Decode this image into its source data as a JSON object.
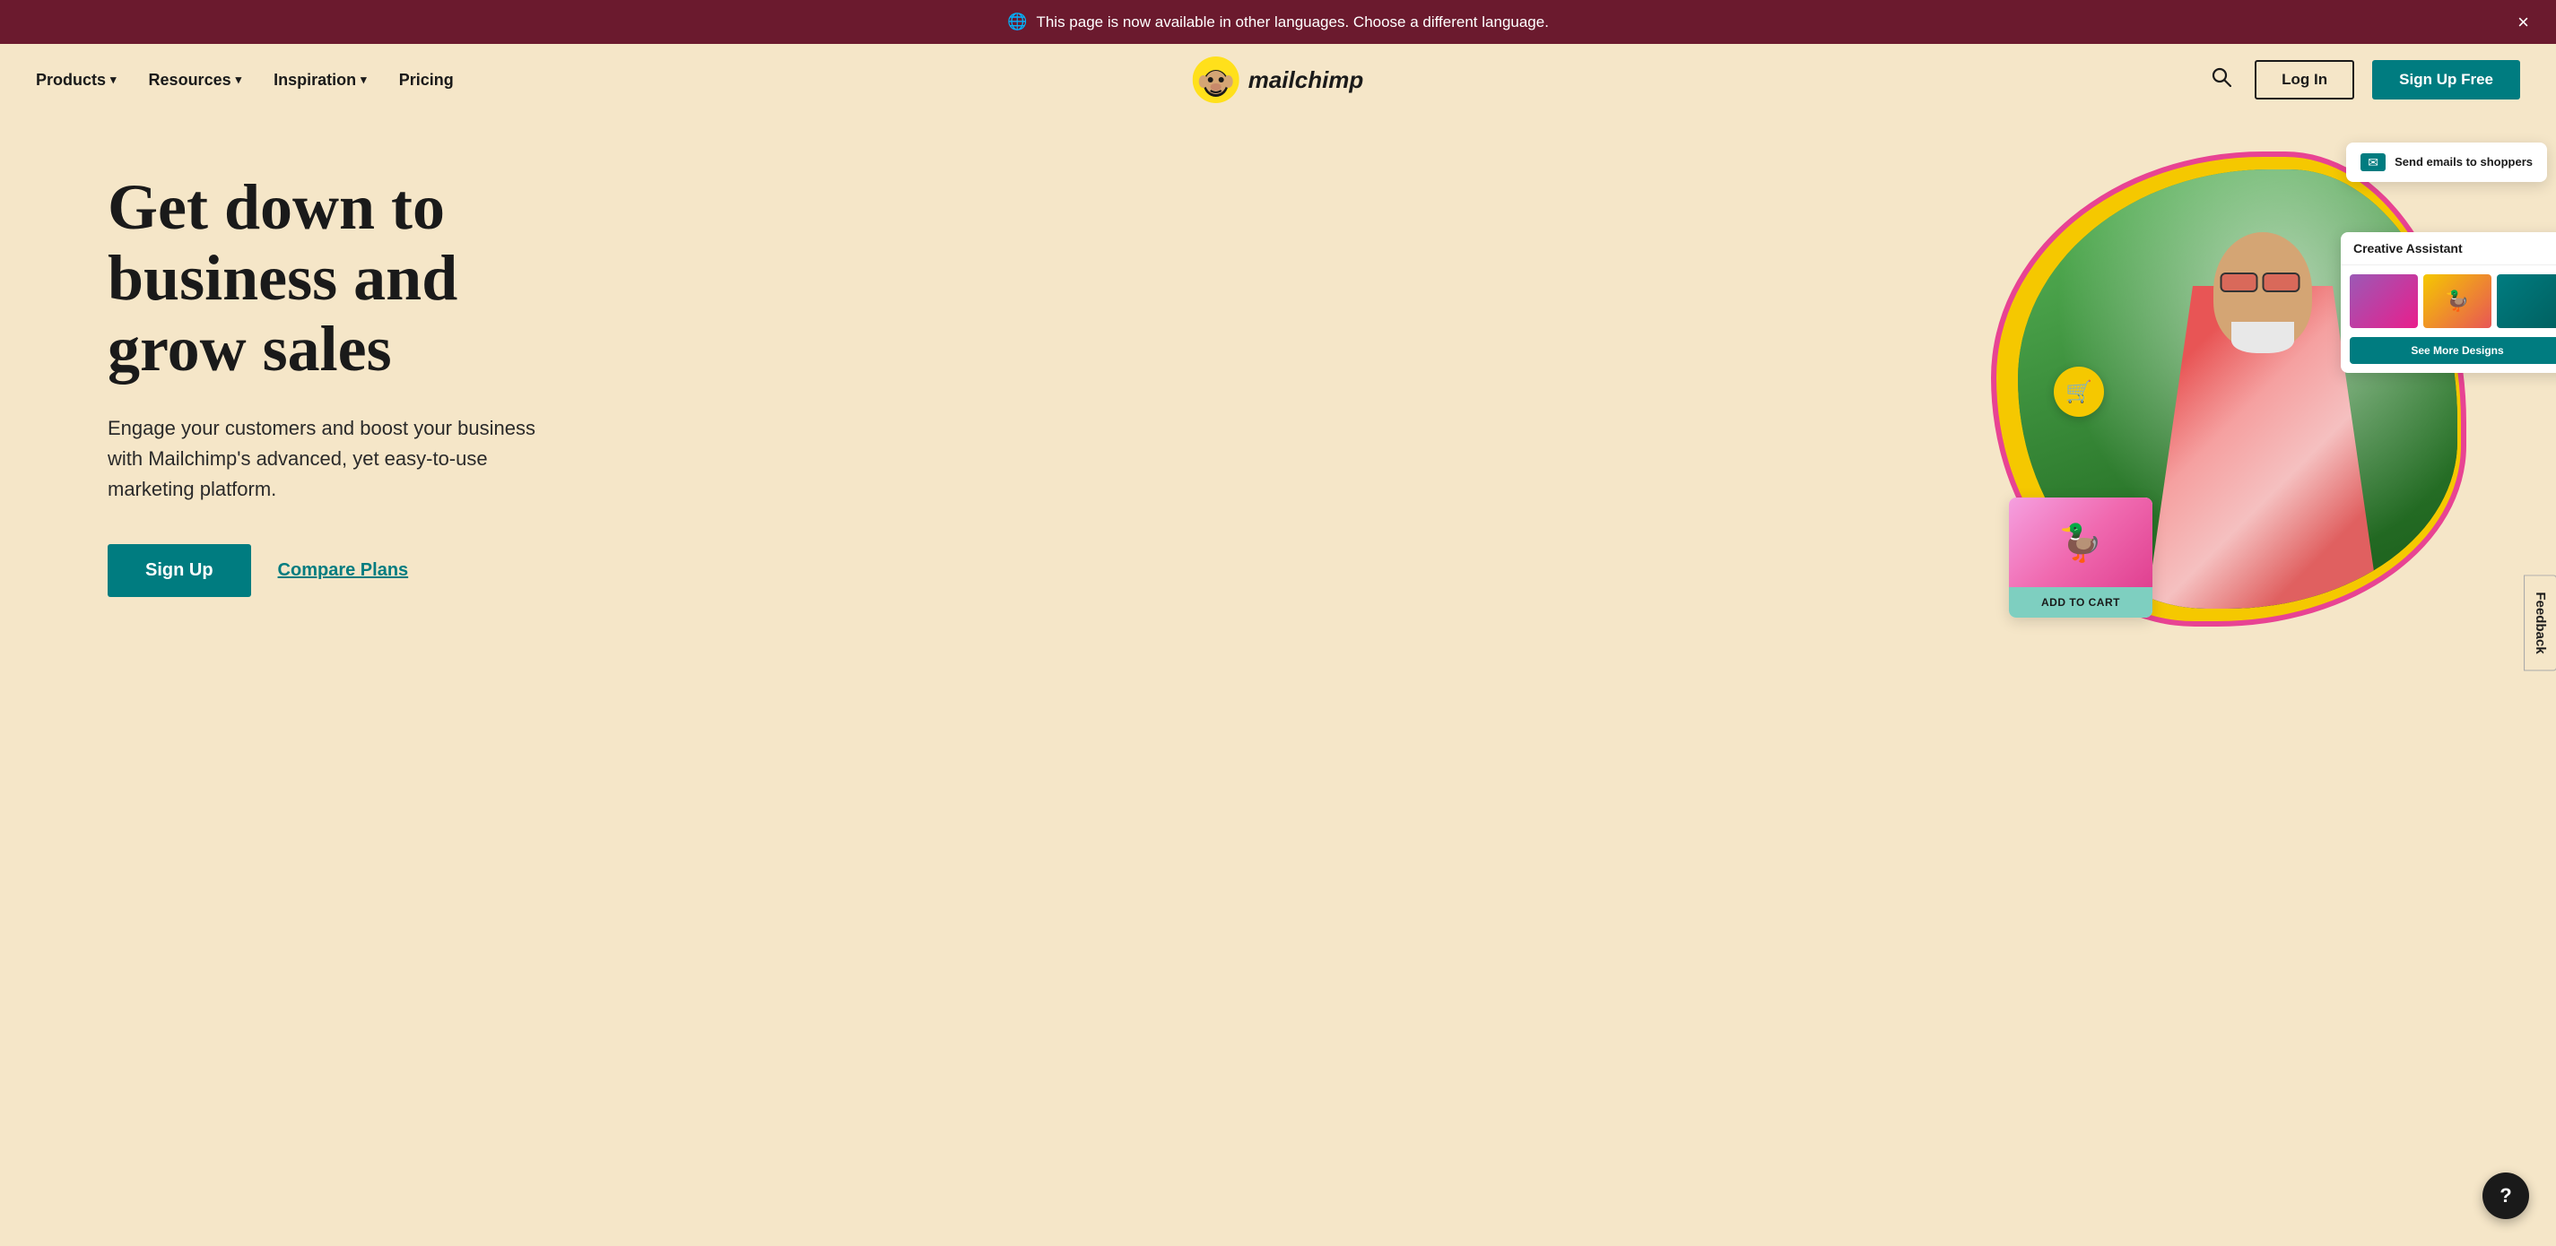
{
  "banner": {
    "text": "This page is now available in other languages. Choose a different language.",
    "close_label": "×"
  },
  "nav": {
    "products_label": "Products",
    "resources_label": "Resources",
    "inspiration_label": "Inspiration",
    "pricing_label": "Pricing",
    "logo_text": "mailchimp",
    "login_label": "Log In",
    "signup_label": "Sign Up Free"
  },
  "hero": {
    "heading": "Get down to business and grow sales",
    "subtext": "Engage your customers and boost your business with Mailchimp's advanced, yet easy-to-use marketing platform.",
    "signup_label": "Sign Up",
    "compare_label": "Compare Plans"
  },
  "cards": {
    "email_label": "Send emails to shoppers",
    "creative_assistant_label": "Creative Assistant",
    "see_more_label": "See More Designs",
    "add_to_cart_label": "ADD TO CART",
    "duck_emoji": "🦆"
  },
  "feedback": {
    "label": "Feedback"
  },
  "help": {
    "label": "?"
  }
}
